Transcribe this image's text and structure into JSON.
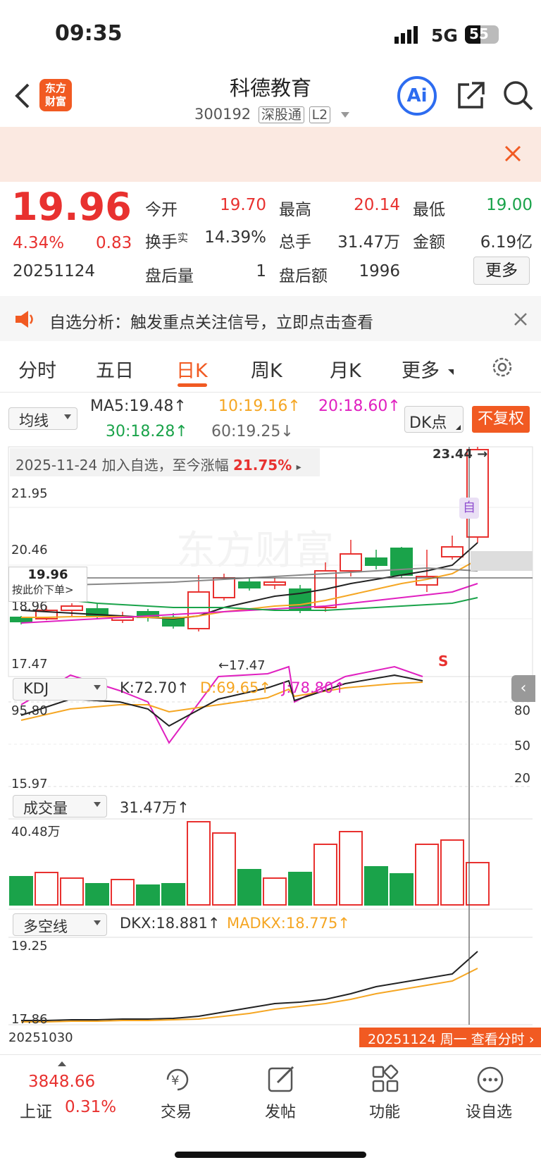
{
  "status_bar": {
    "time": "09:35",
    "network": "5G",
    "battery": "55"
  },
  "header": {
    "title": "科德教育",
    "code": "300192",
    "badge1": "深股通",
    "badge2": "L2",
    "logo_line1": "东方",
    "logo_line2": "财富",
    "ai_label": "Ai"
  },
  "quote": {
    "price": "19.96",
    "change_pct": "4.34%",
    "change": "0.83",
    "date": "20251124",
    "open_label": "今开",
    "open": "19.70",
    "high_label": "最高",
    "high": "20.14",
    "low_label": "最低",
    "low": "19.00",
    "turnover_label": "换手",
    "turnover_sup": "实",
    "turnover": "14.39%",
    "volume_label": "总手",
    "volume": "31.47万",
    "amount_label": "金额",
    "amount": "6.19亿",
    "after_vol_label": "盘后量",
    "after_vol": "1",
    "after_amt_label": "盘后额",
    "after_amt": "1996",
    "more_label": "更多"
  },
  "notice": {
    "text": "自选分析：触发重点关注信号，立即点击查看"
  },
  "tabs": [
    "分时",
    "五日",
    "日K",
    "周K",
    "月K",
    "更多"
  ],
  "active_tab": "日K",
  "ma": {
    "selector": "均线",
    "ma5": "MA5:19.48↑",
    "ma10": "10:19.16↑",
    "ma20": "20:18.60↑",
    "ma30": "30:18.28↑",
    "ma60": "60:19.25↓",
    "dk_button": "DK点",
    "fq_button": "不复权"
  },
  "kline": {
    "banner_date": "2025-11-24 加入自选，至今涨幅",
    "banner_pct": "21.75%",
    "high_label": "23.44",
    "low_label": "17.47",
    "y_labels": [
      "21.95",
      "20.46",
      "18.96",
      "17.47"
    ],
    "cursor_price": "19.96",
    "cursor_hint": "按此价下单>",
    "self_mark": "自",
    "s_mark": "S",
    "watermark": "东方财富"
  },
  "kdj": {
    "selector": "KDJ",
    "k": "K:72.70↑",
    "d": "D:69.65↑",
    "j": "J:78.80↑",
    "y_top": "95.80",
    "y_bottom": "15.97",
    "r80": "80",
    "r50": "50",
    "r20": "20"
  },
  "volume": {
    "selector": "成交量",
    "value": "31.47万↑",
    "y_top": "40.48万"
  },
  "dkx": {
    "selector": "多空线",
    "dkx": "DKX:18.881↑",
    "madkx": "MADKX:18.775↑",
    "y_top": "19.25",
    "y_bottom": "17.86",
    "start_date": "20251030",
    "end_date": "20251124 周一 查看分时"
  },
  "bottom_nav": {
    "index_value": "3848.66",
    "index_name": "上证",
    "index_pct": "0.31%",
    "trade": "交易",
    "post": "发帖",
    "func": "功能",
    "watch": "设自选"
  },
  "colors": {
    "up": "#e8312f",
    "down": "#1aa34a",
    "orange_accent": "#f15a22"
  }
}
